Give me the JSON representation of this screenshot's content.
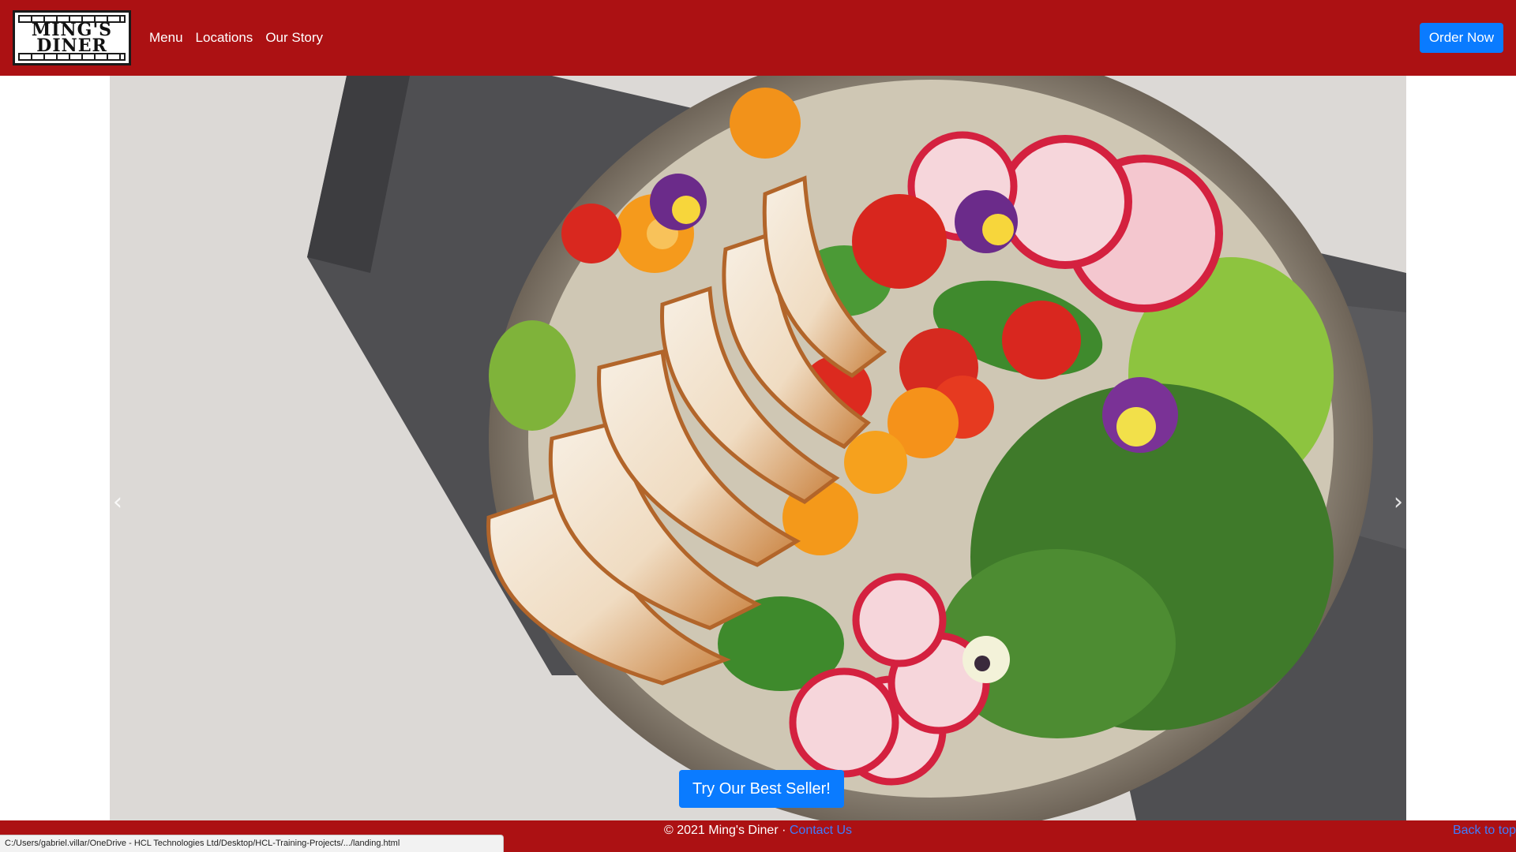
{
  "brand": {
    "line1": "Ming's",
    "line2": "Diner"
  },
  "nav": {
    "links": [
      {
        "label": "Menu"
      },
      {
        "label": "Locations"
      },
      {
        "label": "Our Story"
      }
    ],
    "order_label": "Order Now"
  },
  "carousel": {
    "prev_icon": "chevron-left-icon",
    "next_icon": "chevron-right-icon",
    "prev_glyph": "‹",
    "next_glyph": "›",
    "cta_label": "Try Our Best Seller!"
  },
  "footer": {
    "copyright": "© 2021 Ming's Diner · ",
    "contact_label": "Contact Us",
    "back_to_top": "Back to top"
  },
  "status_bar": {
    "url": "C:/Users/gabriel.villar/OneDrive - HCL Technologies Ltd/Desktop/HCL-Training-Projects/.../landing.html"
  },
  "colors": {
    "brand_red": "#ac1113",
    "primary_blue": "#0a7bff",
    "link_blue": "#3d7cff"
  }
}
